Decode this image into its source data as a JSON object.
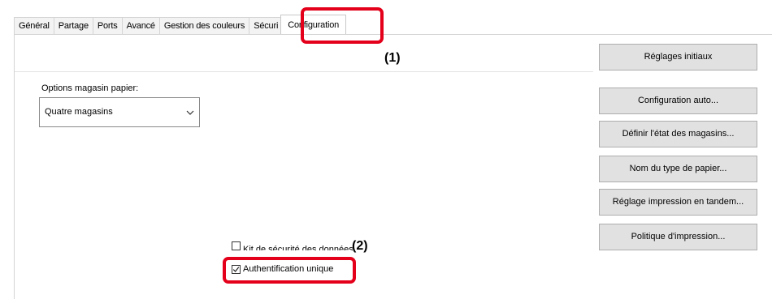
{
  "tabs": [
    {
      "label": "Général"
    },
    {
      "label": "Partage"
    },
    {
      "label": "Ports"
    },
    {
      "label": "Avancé"
    },
    {
      "label": "Gestion des couleurs"
    },
    {
      "label": "Sécuri"
    },
    {
      "label": "Configuration",
      "active": true
    }
  ],
  "tray_options": {
    "label": "Options magasin papier:",
    "selected": "Quatre magasins"
  },
  "buttons": {
    "initial_settings": "Réglages initiaux",
    "auto_config": "Configuration auto...",
    "tray_status": "Définir l'état des magasins...",
    "paper_type_name": "Nom du type de papier...",
    "tandem_print": "Réglage impression en tandem...",
    "print_policy": "Politique d'impression..."
  },
  "checkboxes": {
    "data_security_kit": {
      "label": "Kit de sécurité des données",
      "checked": false
    },
    "single_sign_on": {
      "label": "Authentification unique",
      "checked": true
    }
  },
  "callouts": {
    "callout_1": "(1)",
    "callout_2": "(2)"
  },
  "colors": {
    "callout_red": "#e4001b",
    "button_face": "#e1e1e1"
  }
}
